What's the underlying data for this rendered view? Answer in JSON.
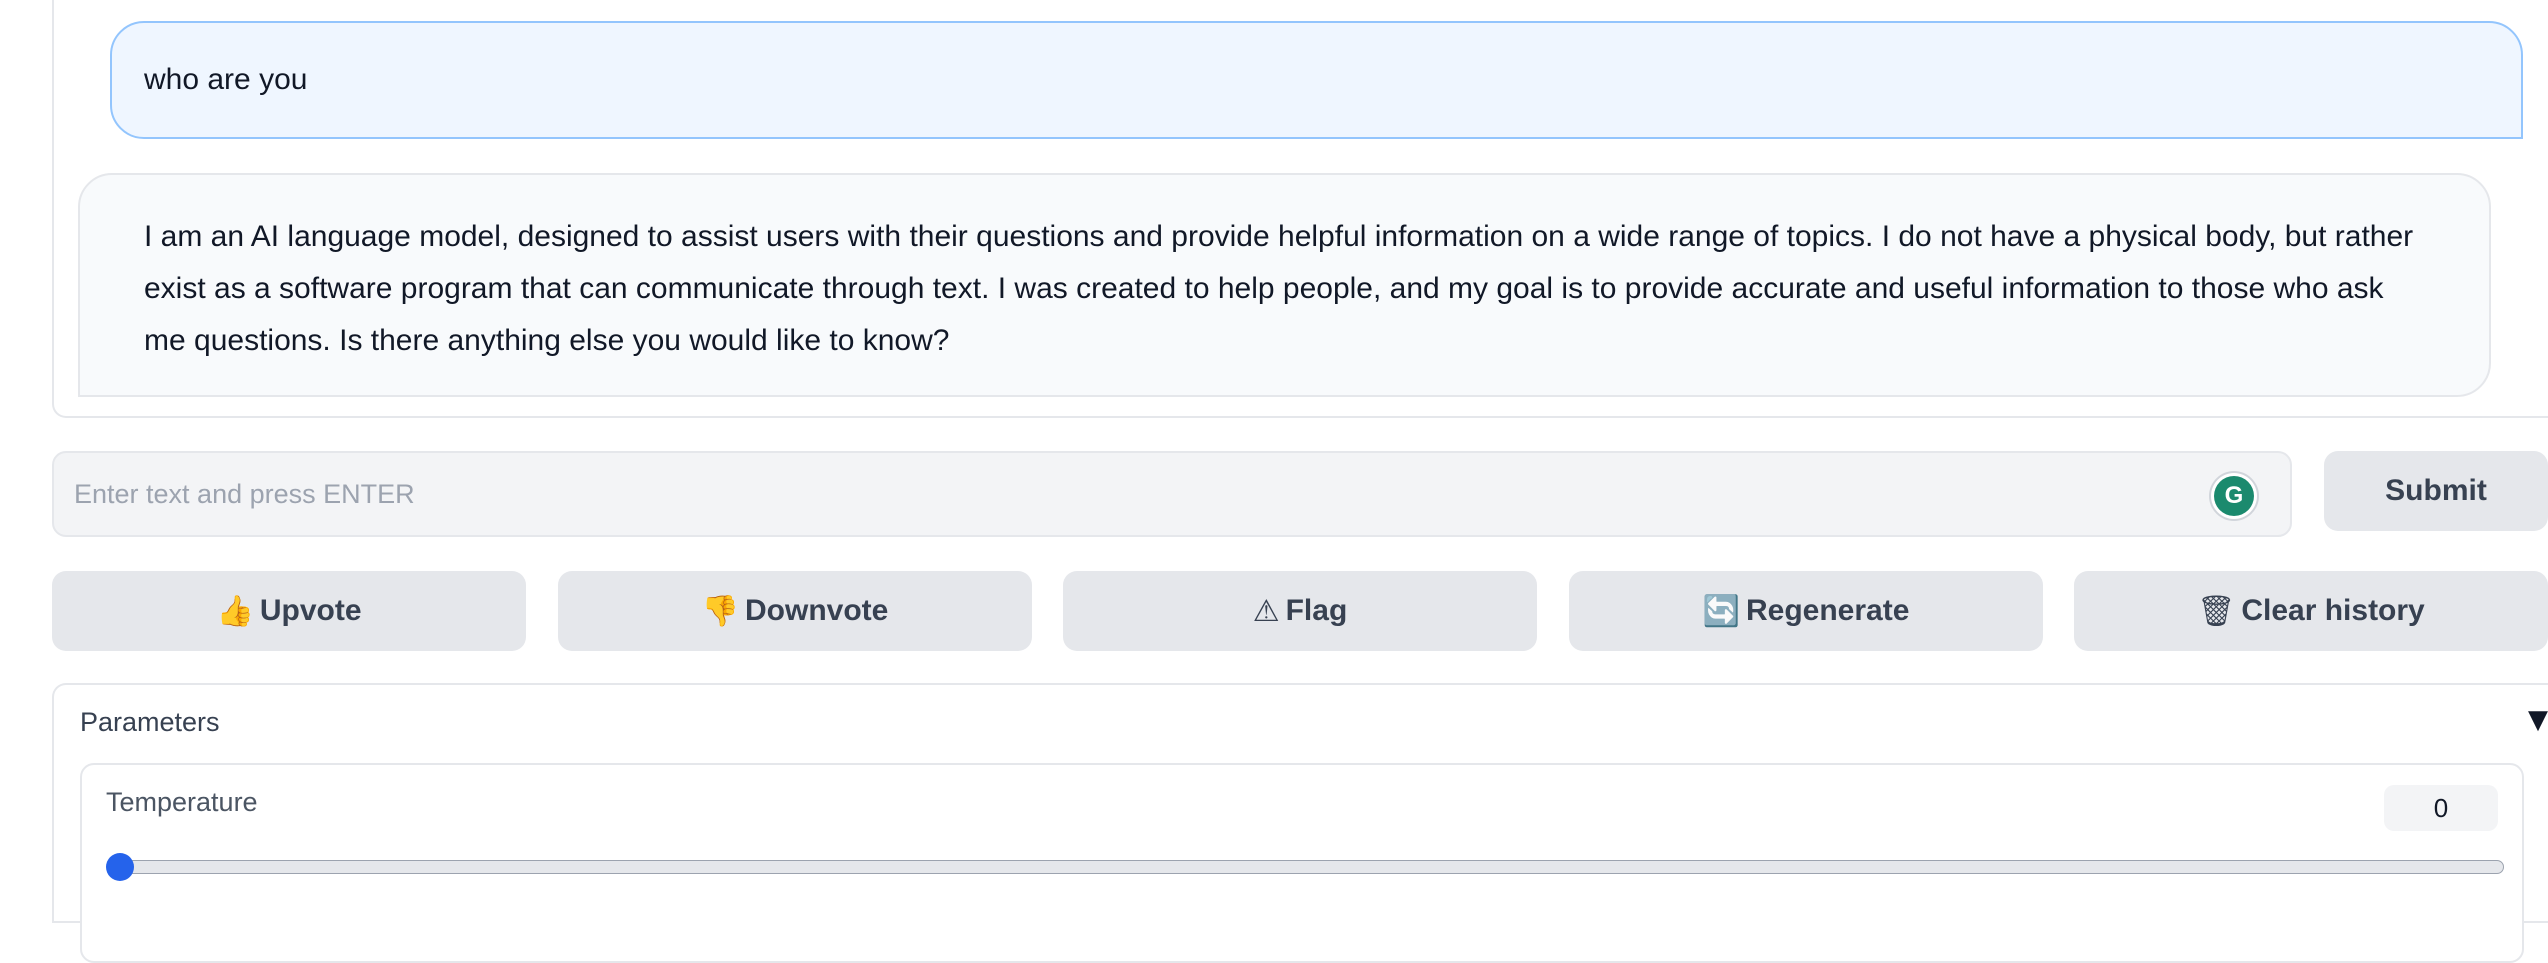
{
  "chat": {
    "user_message": "who are you",
    "bot_message": "I am an AI language model, designed to assist users with their questions and provide helpful information on a wide range of topics. I do not have a physical body, but rather exist as a software program that can communicate through text. I was created to help people, and my goal is to provide accurate and useful information to those who ask me questions. Is there anything else you would like to know?"
  },
  "input": {
    "placeholder": "Enter text and press ENTER",
    "value": "",
    "grammarly_icon": "grammarly-icon"
  },
  "submit_label": "Submit",
  "actions": [
    {
      "icon": "👍",
      "label": "Upvote"
    },
    {
      "icon": "👎",
      "label": "Downvote"
    },
    {
      "icon": "⚠",
      "label": "Flag"
    },
    {
      "icon": "🔄",
      "label": "Regenerate"
    },
    {
      "icon": "🗑",
      "label": "Clear history"
    }
  ],
  "parameters": {
    "title": "Parameters",
    "caret_icon": "▼",
    "temperature": {
      "label": "Temperature",
      "value": "0",
      "slider_fraction": 0
    }
  },
  "colors": {
    "user_bubble_bg": "#eff6ff",
    "user_bubble_border": "#93c5fd",
    "button_bg": "#e5e7eb",
    "slider_accent": "#2563eb"
  }
}
